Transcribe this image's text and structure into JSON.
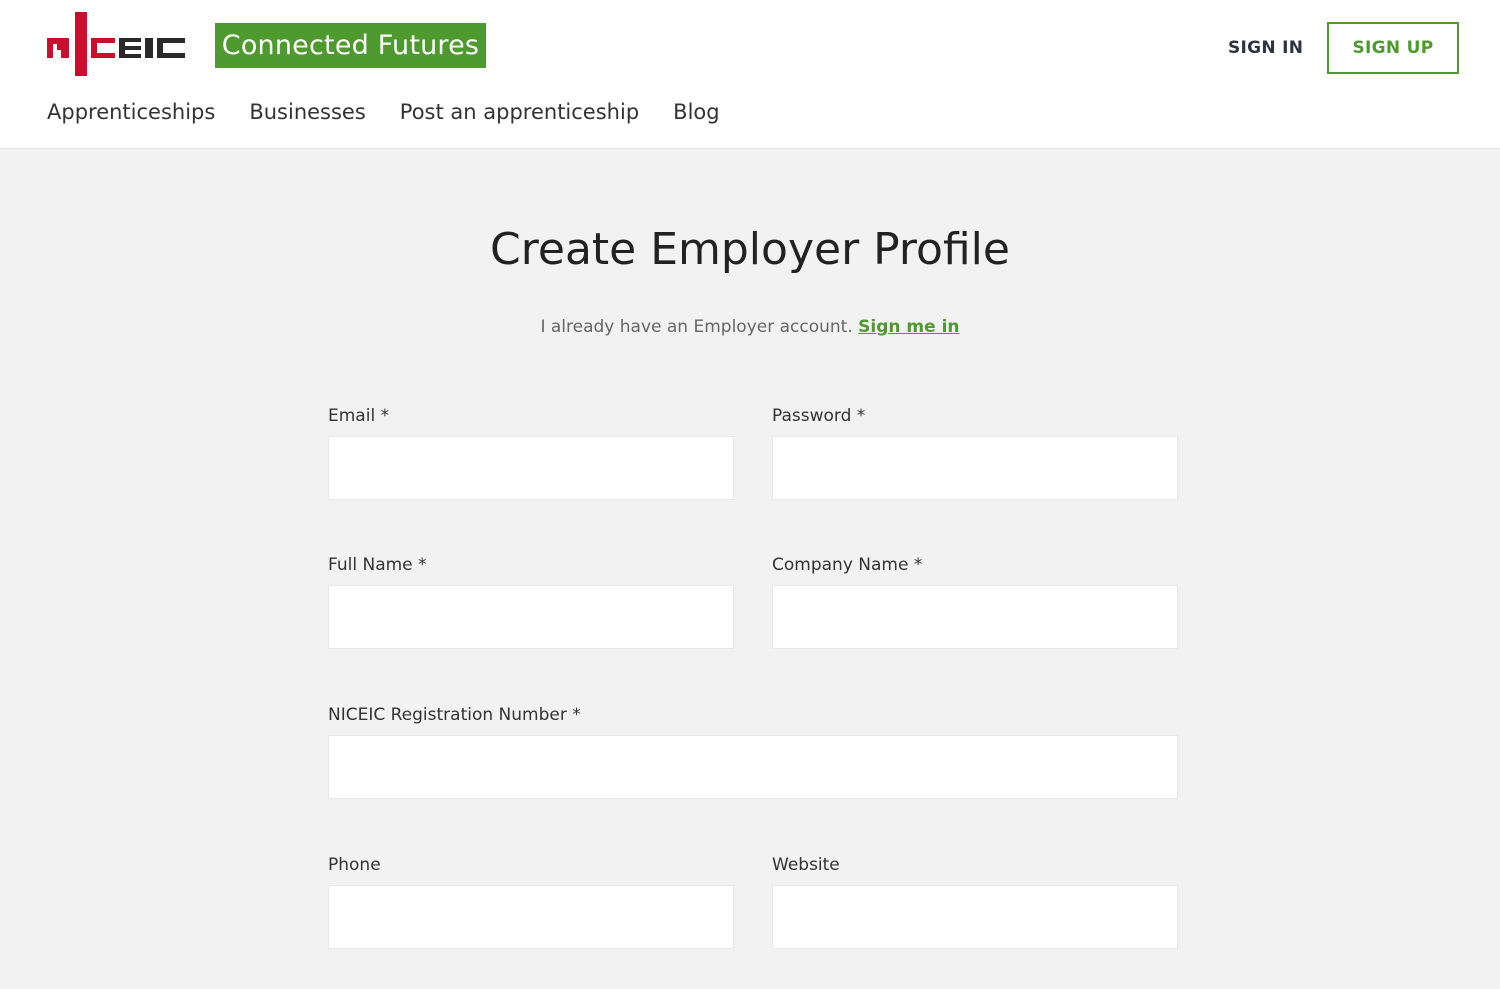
{
  "brand": {
    "logo_text": "niceic",
    "tagline": "Connected Futures",
    "accent_color": "#4f9a2f",
    "logo_red": "#c8102e"
  },
  "nav": {
    "items": [
      "Apprenticeships",
      "Businesses",
      "Post an apprenticeship",
      "Blog"
    ]
  },
  "auth": {
    "sign_in": "SIGN IN",
    "sign_up": "SIGN UP"
  },
  "main": {
    "title": "Create Employer Profile",
    "already_text": "I already have an Employer account.",
    "sign_me_in": "Sign me in"
  },
  "form": {
    "email": {
      "label": "Email *",
      "value": ""
    },
    "password": {
      "label": "Password *",
      "value": ""
    },
    "full_name": {
      "label": "Full Name *",
      "value": ""
    },
    "company_name": {
      "label": "Company Name *",
      "value": ""
    },
    "registration_number": {
      "label": "NICEIC Registration Number *",
      "value": ""
    },
    "phone": {
      "label": "Phone",
      "value": ""
    },
    "website": {
      "label": "Website",
      "value": ""
    }
  }
}
